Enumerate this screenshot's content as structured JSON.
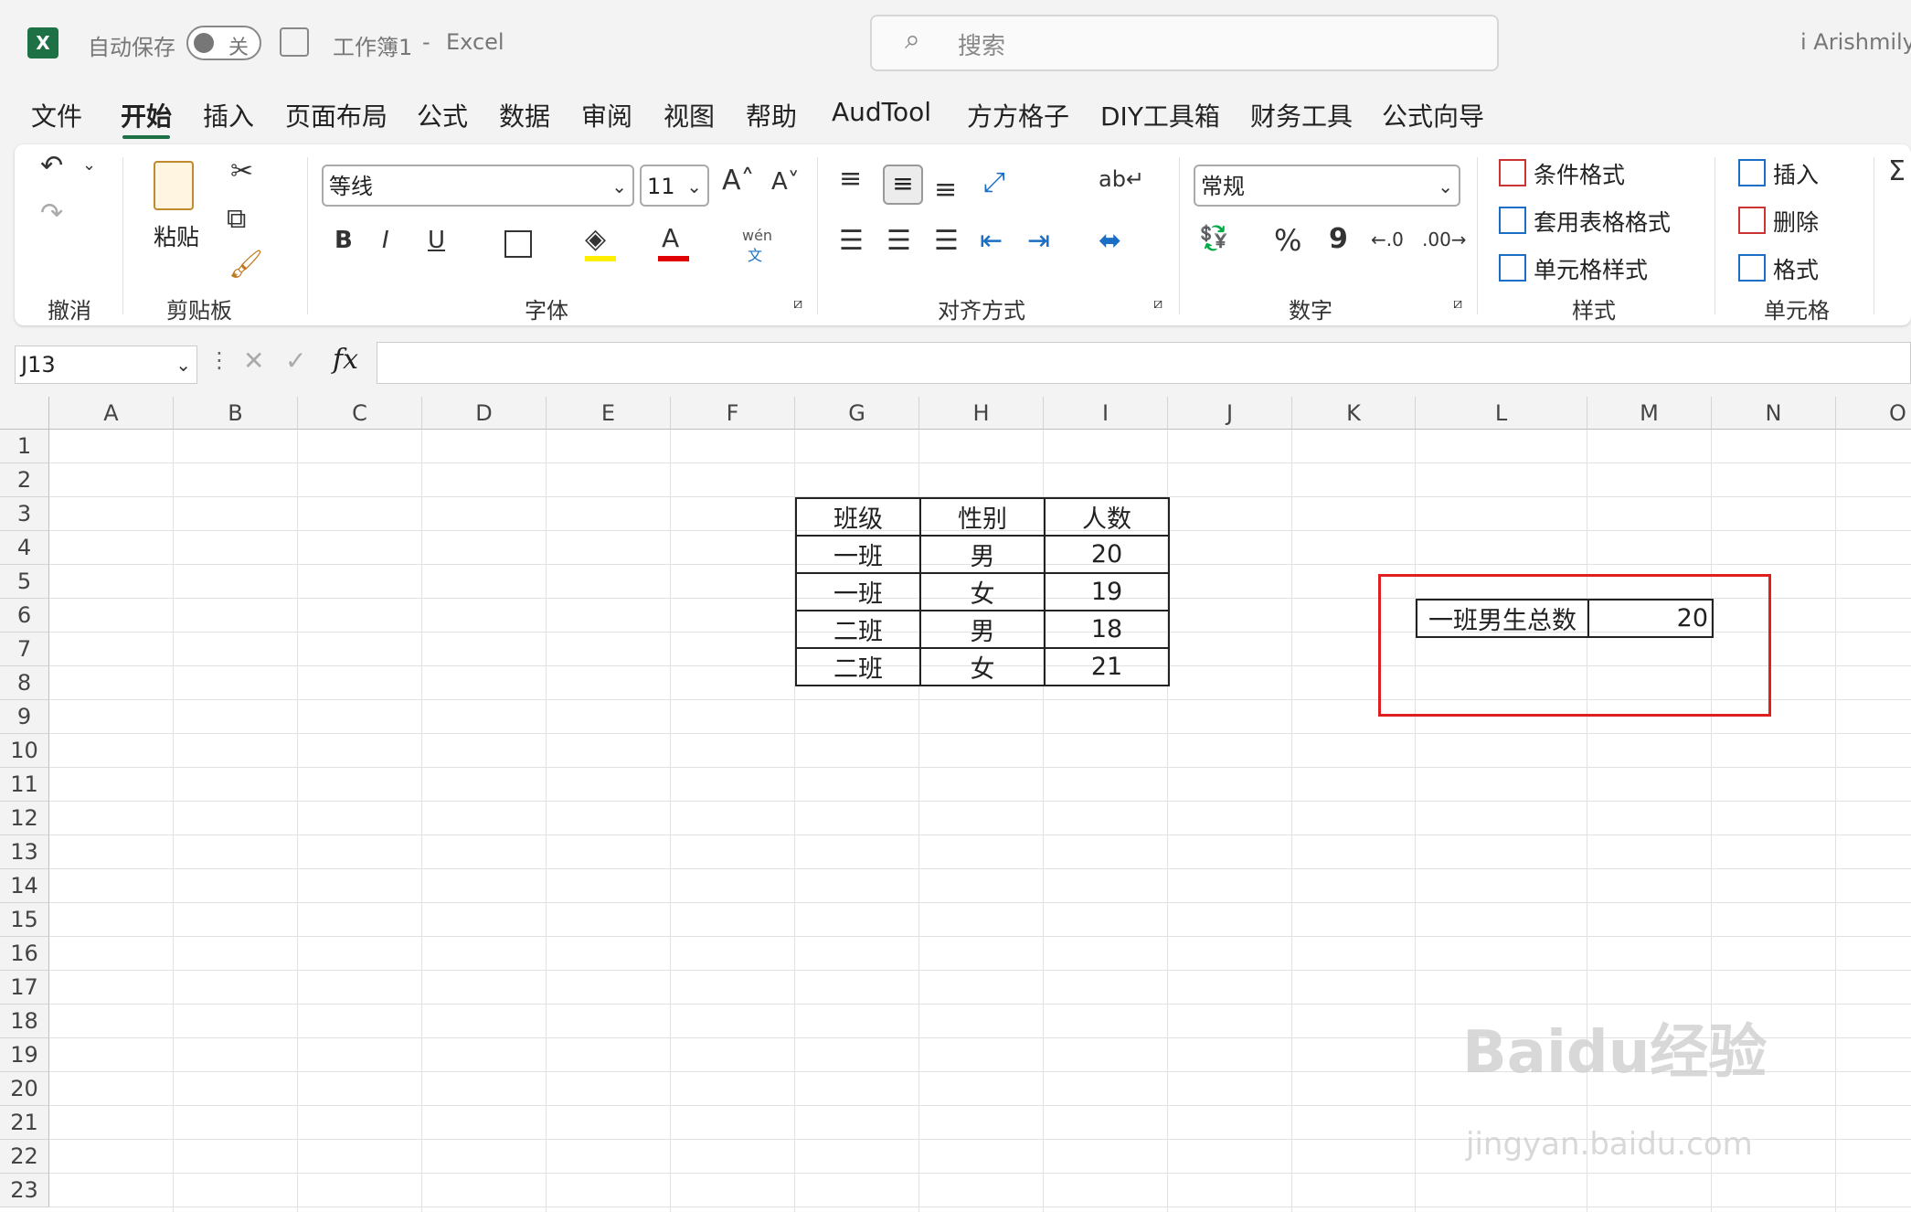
{
  "titlebar": {
    "autosave_label": "自动保存",
    "autosave_state": "关",
    "doc_title": "工作簿1",
    "dash": "-",
    "app_name": "Excel",
    "search_placeholder": "搜索",
    "user": "i Arishmily"
  },
  "menu": [
    "文件",
    "开始",
    "插入",
    "页面布局",
    "公式",
    "数据",
    "审阅",
    "视图",
    "帮助",
    "AudTool",
    "方方格子",
    "DIY工具箱",
    "财务工具",
    "公式向导"
  ],
  "ribbon": {
    "undo_group": "撤消",
    "clipboard_group": "剪贴板",
    "paste_label": "粘贴",
    "font_group": "字体",
    "font_name": "等线",
    "font_size": "11",
    "bold": "B",
    "italic": "I",
    "underline": "U",
    "font_color_letter": "A",
    "phonetic": "wén",
    "phonetic_sub": "文",
    "align_group": "对齐方式",
    "number_group": "数字",
    "number_format": "常规",
    "percent": "%",
    "comma": "9",
    "styles_group": "样式",
    "cond_format": "条件格式",
    "table_format": "套用表格格式",
    "cell_styles": "单元格样式",
    "cells_group": "单元格",
    "insert": "插入",
    "delete": "删除",
    "format": "格式",
    "colors": {
      "accent": "#1e7145",
      "fill_yellow": "#ffee00",
      "font_red": "#e00000"
    }
  },
  "formula_bar": {
    "name_box": "J13",
    "fx": "fx",
    "value": ""
  },
  "columns": [
    "A",
    "B",
    "C",
    "D",
    "E",
    "F",
    "G",
    "H",
    "I",
    "J",
    "K",
    "L",
    "M",
    "N",
    "O"
  ],
  "rows": [
    "1",
    "2",
    "3",
    "4",
    "5",
    "6",
    "7",
    "8",
    "9",
    "10",
    "11",
    "12",
    "13",
    "14",
    "15",
    "16",
    "17",
    "18",
    "19",
    "20",
    "21",
    "22",
    "23"
  ],
  "table": {
    "headers": [
      "班级",
      "性别",
      "人数"
    ],
    "rows": [
      [
        "一班",
        "男",
        "20"
      ],
      [
        "一班",
        "女",
        "19"
      ],
      [
        "二班",
        "男",
        "18"
      ],
      [
        "二班",
        "女",
        "21"
      ]
    ]
  },
  "result": {
    "label": "一班男生总数",
    "value": "20"
  },
  "watermark": {
    "brand": "Baidu经验",
    "url": "jingyan.baidu.com"
  }
}
